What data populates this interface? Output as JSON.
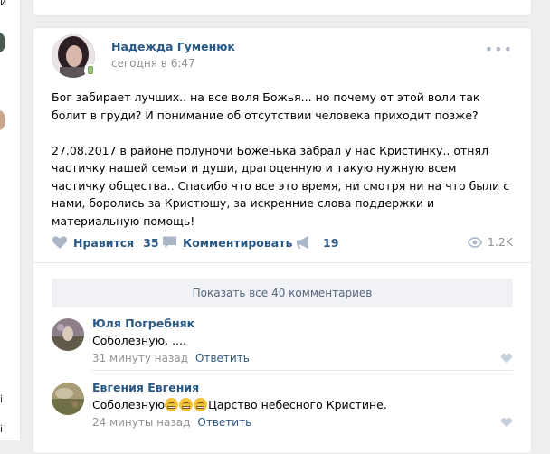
{
  "left_strip": {
    "top_char": "и",
    "lower_char": "і"
  },
  "post": {
    "author": "Надежда Гуменюк",
    "time": "сегодня в 6:47",
    "more_icon": "more-horizontal-icon",
    "paragraphs": [
      "Бог забирает лучших.. на все воля Божья... но почему от этой воли так болит в груди? И понимание об отсутствии человека приходит позже?",
      "27.08.2017 в районе полуночи Боженька забрал у нас Кристинку.. отнял частичку нашей семьи и души, драгоценную и такую нужную всем частичку общества.. Спасибо что все это время, ни смотря ни на что были с нами, боролись за Кристюшу, за искренние слова поддержки и материальную помощь!"
    ],
    "actions": {
      "like_label": "Нравится",
      "like_count": "35",
      "comment_label": "Комментировать",
      "share_count": "19",
      "views": "1.2K"
    }
  },
  "comments": {
    "show_all_label": "Показать все 40 комментариев",
    "items": [
      {
        "name": "Юля Погребняк",
        "text": "Соболезную. ....",
        "time": "31 минуту назад",
        "reply": "Ответить"
      },
      {
        "name": "Евгения Евгения",
        "text_before": "Соболезную",
        "emoji_count": 3,
        "text_after": "Царство небесного Кристине.",
        "time": "24 минуты назад",
        "reply": "Ответить"
      }
    ]
  },
  "colors": {
    "link": "#2a5885",
    "muted": "#939393",
    "icon": "#aab7c7",
    "background": "#edeef0"
  }
}
